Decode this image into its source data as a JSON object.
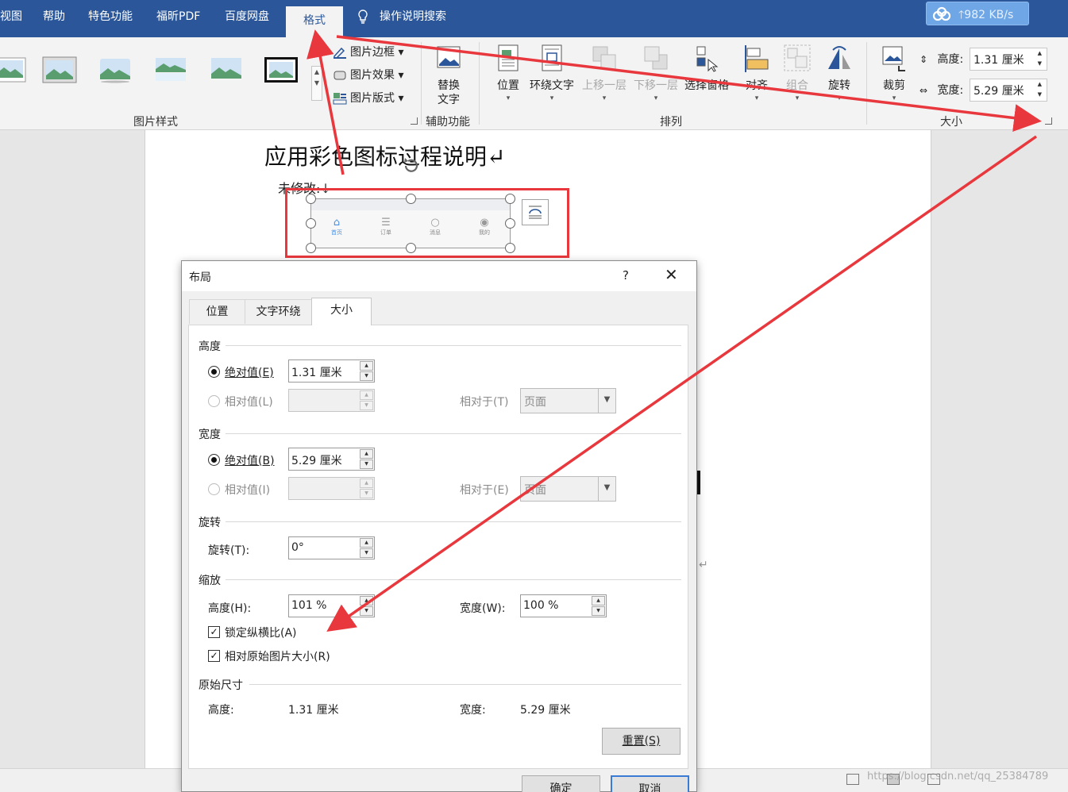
{
  "menubar": {
    "items": [
      "视图",
      "帮助",
      "特色功能",
      "福昕PDF",
      "百度网盘"
    ],
    "active_tab": "格式",
    "search": "操作说明搜索",
    "cloud_speed": "982 KB/s"
  },
  "ribbon": {
    "picture_styles_label": "图片样式",
    "picture_border": "图片边框",
    "picture_effects": "图片效果",
    "picture_layout": "图片版式",
    "accessibility_label": "辅助功能",
    "alt_text_line1": "替换",
    "alt_text_line2": "文字",
    "arrange_label": "排列",
    "position": "位置",
    "wrap_text": "环绕文字",
    "bring_forward": "上移一层",
    "send_backward": "下移一层",
    "selection_pane": "选择窗格",
    "align": "对齐",
    "group": "组合",
    "rotate": "旋转",
    "crop": "裁剪",
    "size_label": "大小",
    "height_label": "高度:",
    "height_value": "1.31 厘米",
    "width_label": "宽度:",
    "width_value": "5.29 厘米"
  },
  "document": {
    "title": "应用彩色图标过程说明↵",
    "subtitle": "未修改:↓",
    "nav_labels": [
      "首页",
      "订单",
      "消息",
      "我的"
    ],
    "para_mark": "↵"
  },
  "dialog": {
    "title": "布局",
    "help": "?",
    "tabs": [
      "位置",
      "文字环绕",
      "大小"
    ],
    "height_section": "高度",
    "absolute_h": "绝对值(E)",
    "absolute_h_value": "1.31 厘米",
    "relative_h": "相对值(L)",
    "relative_to_t": "相对于(T)",
    "page_t": "页面",
    "width_section": "宽度",
    "absolute_w": "绝对值(B)",
    "absolute_w_value": "5.29 厘米",
    "relative_w": "相对值(I)",
    "relative_to_e": "相对于(E)",
    "page_e": "页面",
    "rotate_section": "旋转",
    "rotation_label": "旋转(T):",
    "rotation_value": "0°",
    "scale_section": "缩放",
    "scale_h_label": "高度(H):",
    "scale_h_value": "101 %",
    "scale_w_label": "宽度(W):",
    "scale_w_value": "100 %",
    "lock_aspect": "锁定纵横比(A)",
    "relative_original": "相对原始图片大小(R)",
    "original_section": "原始尺寸",
    "orig_h_label": "高度:",
    "orig_h_value": "1.31 厘米",
    "orig_w_label": "宽度:",
    "orig_w_value": "5.29 厘米",
    "reset": "重置(S)",
    "ok": "确定",
    "cancel": "取消"
  },
  "status": {
    "watermark": "https://blog.csdn.net/qq_25384789"
  },
  "colors": {
    "ribbon_blue": "#2b579a",
    "annotation_red": "#e8383d"
  }
}
